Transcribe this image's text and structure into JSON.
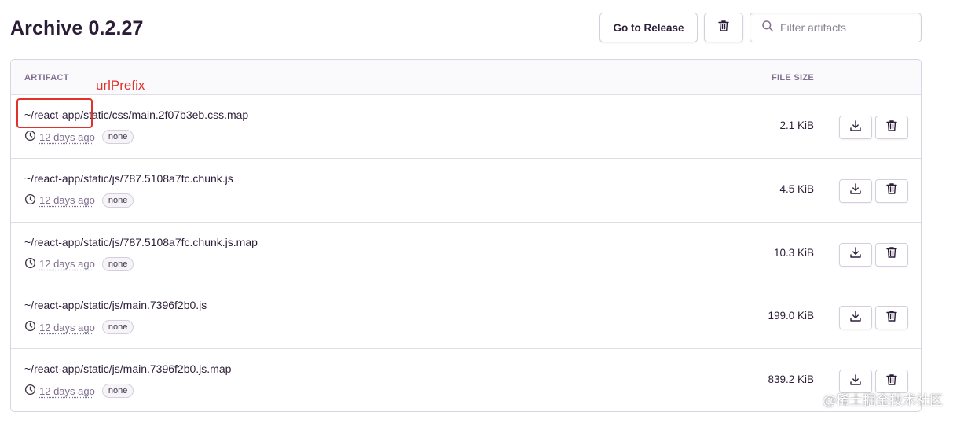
{
  "header": {
    "title": "Archive 0.2.27",
    "go_to_release_label": "Go to Release",
    "delete_icon": "trash-icon",
    "search_placeholder": "Filter artifacts",
    "search_value": "",
    "search_icon": "search-icon"
  },
  "table": {
    "col_artifact": "ARTIFACT",
    "col_size": "FILE SIZE",
    "rows": [
      {
        "name": "~/react-app/static/css/main.2f07b3eb.css.map",
        "time": "12 days ago",
        "tag": "none",
        "size": "2.1 KiB"
      },
      {
        "name": "~/react-app/static/js/787.5108a7fc.chunk.js",
        "time": "12 days ago",
        "tag": "none",
        "size": "4.5 KiB"
      },
      {
        "name": "~/react-app/static/js/787.5108a7fc.chunk.js.map",
        "time": "12 days ago",
        "tag": "none",
        "size": "10.3 KiB"
      },
      {
        "name": "~/react-app/static/js/main.7396f2b0.js",
        "time": "12 days ago",
        "tag": "none",
        "size": "199.0 KiB"
      },
      {
        "name": "~/react-app/static/js/main.7396f2b0.js.map",
        "time": "12 days ago",
        "tag": "none",
        "size": "839.2 KiB"
      }
    ]
  },
  "annotation": {
    "label": "urlPrefix",
    "color": "#e0312b"
  },
  "watermark": "@稀土掘金技术社区"
}
